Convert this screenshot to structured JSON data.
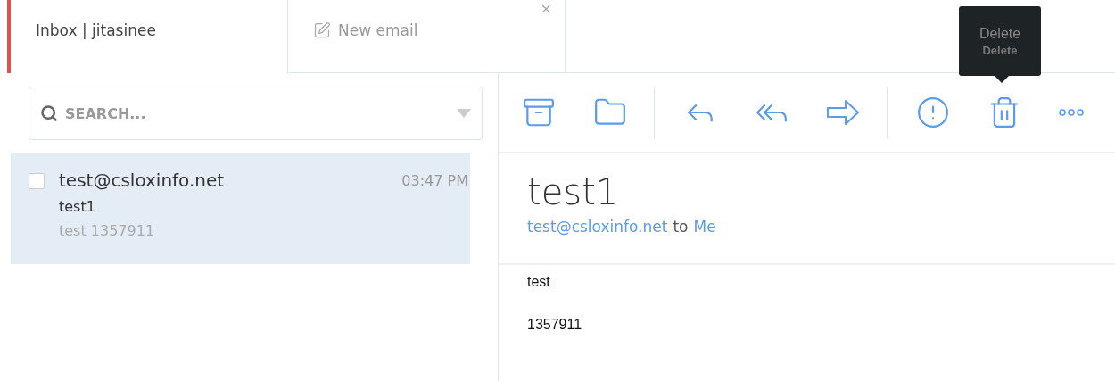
{
  "tabs": [
    {
      "label": "Inbox | jitasinee",
      "selected": true
    },
    {
      "label": "New email",
      "selected": false,
      "close": "×"
    }
  ],
  "search": {
    "placeholder": "SEARCH..."
  },
  "messages": [
    {
      "sender": "test@csloxinfo.net",
      "time": "03:47 PM",
      "subject": "test1",
      "preview": "test 1357911",
      "checked": false,
      "selected": true
    }
  ],
  "toolbar": [
    {
      "kind": "archive"
    },
    {
      "kind": "folder"
    },
    {
      "kind": "divider"
    },
    {
      "kind": "reply"
    },
    {
      "kind": "reply-all"
    },
    {
      "kind": "forward"
    },
    {
      "kind": "divider"
    },
    {
      "kind": "important"
    },
    {
      "kind": "delete",
      "tooltip": {
        "title": "Delete",
        "subtitle": "Delete"
      }
    },
    {
      "kind": "more"
    }
  ],
  "reader": {
    "subject": "test1",
    "from": "test@csloxinfo.net",
    "to_word": "to",
    "to": "Me",
    "body": [
      "test",
      "1357911"
    ]
  }
}
